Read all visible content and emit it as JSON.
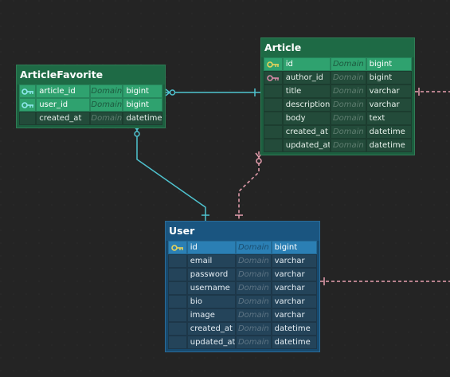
{
  "colors": {
    "background": "#242424",
    "green_table": "#1e6a45",
    "green_pk": "#2fa26f",
    "blue_table": "#1a5580",
    "blue_pk": "#2b7fb4",
    "rel_solid": "#4fc3cf",
    "rel_dashed": "#e8a0b0",
    "pk_key": "#e7d35a",
    "fk_key": "#d88aa8"
  },
  "tables": {
    "article_favorite": {
      "title": "ArticleFavorite",
      "rows": [
        {
          "name": "article_id",
          "domain": "Domain",
          "type": "bigint",
          "key": "pk-fk"
        },
        {
          "name": "user_id",
          "domain": "Domain",
          "type": "bigint",
          "key": "pk-fk"
        },
        {
          "name": "created_at",
          "domain": "Domain",
          "type": "datetime",
          "key": ""
        }
      ]
    },
    "article": {
      "title": "Article",
      "rows": [
        {
          "name": "id",
          "domain": "Domain",
          "type": "bigint",
          "key": "pk"
        },
        {
          "name": "author_id",
          "domain": "Domain",
          "type": "bigint",
          "key": "fk"
        },
        {
          "name": "title",
          "domain": "Domain",
          "type": "varchar",
          "key": ""
        },
        {
          "name": "description",
          "domain": "Domain",
          "type": "varchar",
          "key": ""
        },
        {
          "name": "body",
          "domain": "Domain",
          "type": "text",
          "key": ""
        },
        {
          "name": "created_at",
          "domain": "Domain",
          "type": "datetime",
          "key": ""
        },
        {
          "name": "updated_at",
          "domain": "Domain",
          "type": "datetime",
          "key": ""
        }
      ]
    },
    "user": {
      "title": "User",
      "rows": [
        {
          "name": "id",
          "domain": "Domain",
          "type": "bigint",
          "key": "pk"
        },
        {
          "name": "email",
          "domain": "Domain",
          "type": "varchar",
          "key": ""
        },
        {
          "name": "password",
          "domain": "Domain",
          "type": "varchar",
          "key": ""
        },
        {
          "name": "username",
          "domain": "Domain",
          "type": "varchar",
          "key": ""
        },
        {
          "name": "bio",
          "domain": "Domain",
          "type": "varchar",
          "key": ""
        },
        {
          "name": "image",
          "domain": "Domain",
          "type": "varchar",
          "key": ""
        },
        {
          "name": "created_at",
          "domain": "Domain",
          "type": "datetime",
          "key": ""
        },
        {
          "name": "updated_at",
          "domain": "Domain",
          "type": "datetime",
          "key": ""
        }
      ]
    }
  }
}
